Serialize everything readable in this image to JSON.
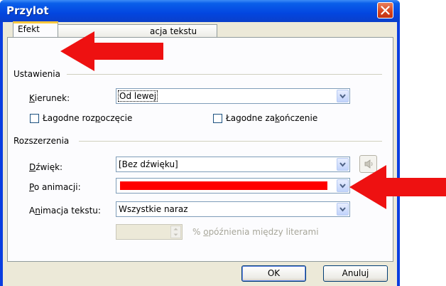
{
  "window": {
    "title": "Przylot"
  },
  "tabs": [
    {
      "label": "Efekt",
      "active": true
    },
    {
      "label": "acja tekstu",
      "active": false
    }
  ],
  "ustawienia": {
    "header": "Ustawienia",
    "kierunek": {
      "label": "Kierunek:",
      "value": "Od lewej"
    },
    "start_check": {
      "label": "Łagodne rozpoczęcie",
      "checked": false
    },
    "end_check": {
      "label": "Łagodne zakończenie",
      "checked": false
    }
  },
  "rozszerzenia": {
    "header": "Rozszerzenia",
    "dzwiek": {
      "label": "Dźwięk:",
      "value": "[Bez dźwięku]"
    },
    "po_animacji": {
      "label": "Po animacji:",
      "value": "",
      "color": "#ff0000"
    },
    "animacja_tekstu": {
      "label": "Animacja tekstu:",
      "value": "Wszystkie naraz"
    },
    "delay_label": "% opóźnienia między literami"
  },
  "buttons": {
    "ok": "OK",
    "cancel": "Anuluj"
  },
  "annotation_color": "#ee1111",
  "icons": [
    "close-icon",
    "speaker-icon",
    "chevron-down-icon"
  ]
}
